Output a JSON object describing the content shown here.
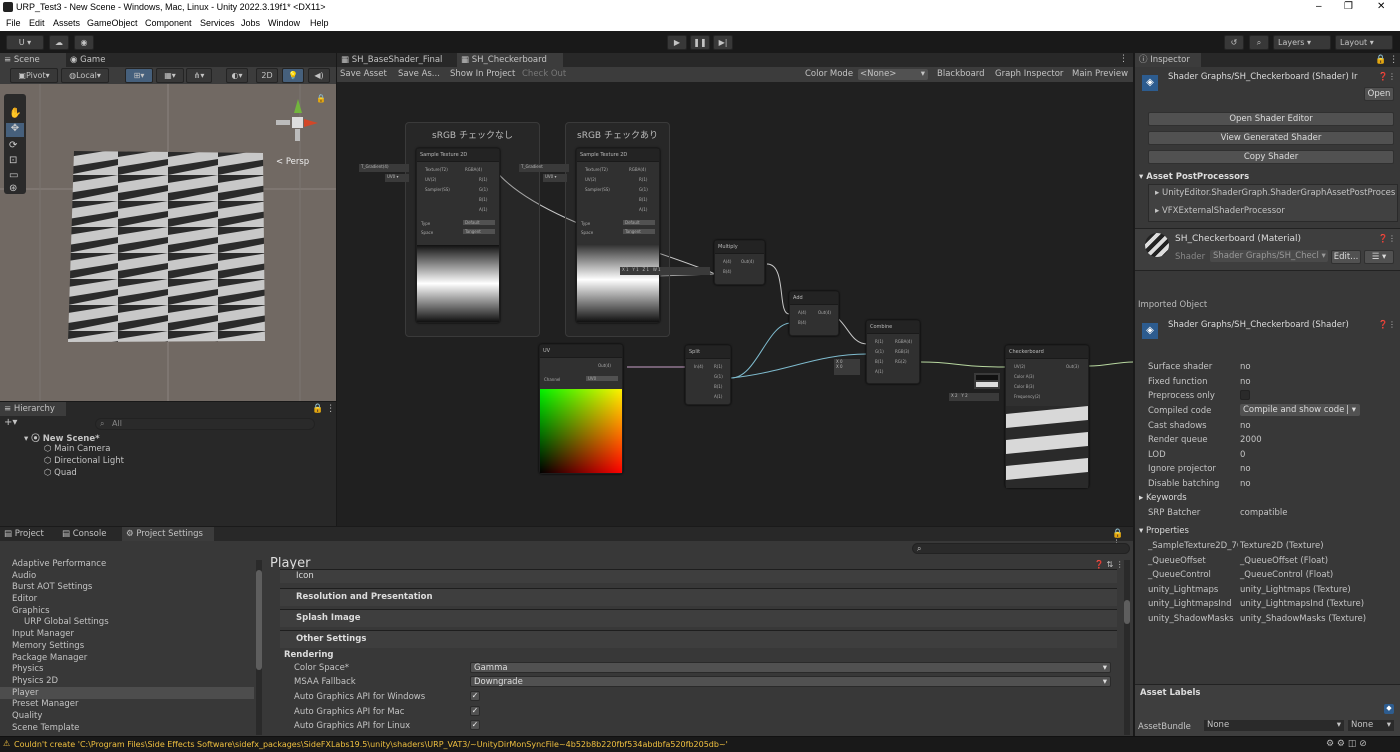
{
  "window": {
    "title": "URP_Test3 - New Scene - Windows, Mac, Linux - Unity 2022.3.19f1* <DX11>",
    "min": "–",
    "max": "❐",
    "close": "✕"
  },
  "menu": [
    "File",
    "Edit",
    "Assets",
    "GameObject",
    "Component",
    "Services",
    "Jobs",
    "Window",
    "Help"
  ],
  "toolbar": {
    "account": "U ▾",
    "layers": "Layers",
    "layout": "Layout"
  },
  "scene": {
    "tab_scene": "Scene",
    "tab_game": "Game",
    "pivot": "Pivot",
    "local": "Local",
    "mode2d": "2D",
    "persp": "< Persp"
  },
  "hierarchy": {
    "title": "Hierarchy",
    "search": "All",
    "scene": "New Scene*",
    "items": [
      "Main Camera",
      "Directional Light",
      "Quad"
    ]
  },
  "shadergraph": {
    "tab1": "SH_BaseShader_Final",
    "tab2": "SH_Checkerboard",
    "save": "Save Asset",
    "saveas": "Save As...",
    "show": "Show In Project",
    "checkout": "Check Out",
    "colormode_label": "Color Mode",
    "colormode_val": "<None>",
    "blackboard": "Blackboard",
    "inspector": "Graph Inspector",
    "preview": "Main Preview",
    "group1": "sRGB チェックなし",
    "group2": "sRGB チェックあり",
    "n_sample1": "Sample Texture 2D",
    "n_sample2": "Sample Texture 2D",
    "n_multiply": "Multiply",
    "n_add": "Add",
    "n_combine": "Combine",
    "n_uv": "UV",
    "n_split": "Split",
    "n_checker": "Checkerboard",
    "in_tex1": "T_Gradient(4)",
    "in_tex2": "T_Gradient",
    "type_label": "Type",
    "type_val1": "Default",
    "type_val2": "Default",
    "space_label": "Space",
    "space_val": "Tangent",
    "channel_label": "Channel",
    "channel_val": "UV0"
  },
  "inspector": {
    "title": "Inspector",
    "header": "Shader Graphs/SH_Checkerboard (Shader) Ir",
    "open": "Open",
    "btn1": "Open Shader Editor",
    "btn2": "View Generated Shader",
    "btn3": "Copy Shader",
    "post_title": "Asset PostProcessors",
    "post1": "UnityEditor.ShaderGraph.ShaderGraphAssetPostProcessor",
    "post2": "VFXExternalShaderProcessor",
    "mat_title": "SH_Checkerboard (Material)",
    "mat_shader_label": "Shader",
    "mat_shader_val": "Shader Graphs/SH_Checl ▾",
    "edit": "Edit...",
    "imported": "Imported Object",
    "shader_header": "Shader Graphs/SH_Checkerboard (Shader)",
    "rows": [
      {
        "k": "Surface shader",
        "v": "no"
      },
      {
        "k": "Fixed function",
        "v": "no"
      },
      {
        "k": "Preprocess only",
        "v": ""
      },
      {
        "k": "Compiled code",
        "v": "Compile and show code"
      },
      {
        "k": "Cast shadows",
        "v": "no"
      },
      {
        "k": "Render queue",
        "v": "2000"
      },
      {
        "k": "LOD",
        "v": "0"
      },
      {
        "k": "Ignore projector",
        "v": "no"
      },
      {
        "k": "Disable batching",
        "v": "no"
      }
    ],
    "keywords": "Keywords",
    "srp_label": "SRP Batcher",
    "srp_val": "compatible",
    "properties": "Properties",
    "props": [
      {
        "k": "_SampleTexture2D_7C",
        "v": "Texture2D (Texture)"
      },
      {
        "k": "_QueueOffset",
        "v": "_QueueOffset (Float)"
      },
      {
        "k": "_QueueControl",
        "v": "_QueueControl (Float)"
      },
      {
        "k": "unity_Lightmaps",
        "v": "unity_Lightmaps (Texture)"
      },
      {
        "k": "unity_LightmapsInd",
        "v": "unity_LightmapsInd (Texture)"
      },
      {
        "k": "unity_ShadowMasks",
        "v": "unity_ShadowMasks (Texture)"
      }
    ],
    "labels": "Asset Labels",
    "bundle_label": "AssetBundle",
    "bundle_val": "None",
    "bundle_val2": "None"
  },
  "bottom": {
    "tab_project": "Project",
    "tab_console": "Console",
    "tab_settings": "Project Settings",
    "list": [
      "Adaptive Performance",
      "Audio",
      "Burst AOT Settings",
      "Editor",
      "Graphics",
      "URP Global Settings",
      "Input Manager",
      "Memory Settings",
      "Package Manager",
      "Physics",
      "Physics 2D",
      "Player",
      "Preset Manager",
      "Quality",
      "Scene Template"
    ],
    "player": "Player",
    "fold_icon": "Icon",
    "fold_res": "Resolution and Presentation",
    "fold_splash": "Splash Image",
    "fold_other": "Other Settings",
    "rendering": "Rendering",
    "color_space_label": "Color Space*",
    "color_space_val": "Gamma",
    "msaa_label": "MSAA Fallback",
    "msaa_val": "Downgrade",
    "auto_win": "Auto Graphics API  for Windows",
    "auto_mac": "Auto Graphics API  for Mac",
    "auto_linux": "Auto Graphics API  for Linux"
  },
  "status": {
    "error": "Couldn't create 'C:\\Program Files\\Side Effects Software\\sidefx_packages\\SideFXLabs19.5\\unity\\shaders\\URP_VAT3/~UnityDirMonSyncFile~4b52b8b220fbf534abdbfa520fb205db~'"
  },
  "colors": {
    "accent": "#2d5c8f",
    "error": "#f0c040",
    "selected": "#2c5d87"
  }
}
